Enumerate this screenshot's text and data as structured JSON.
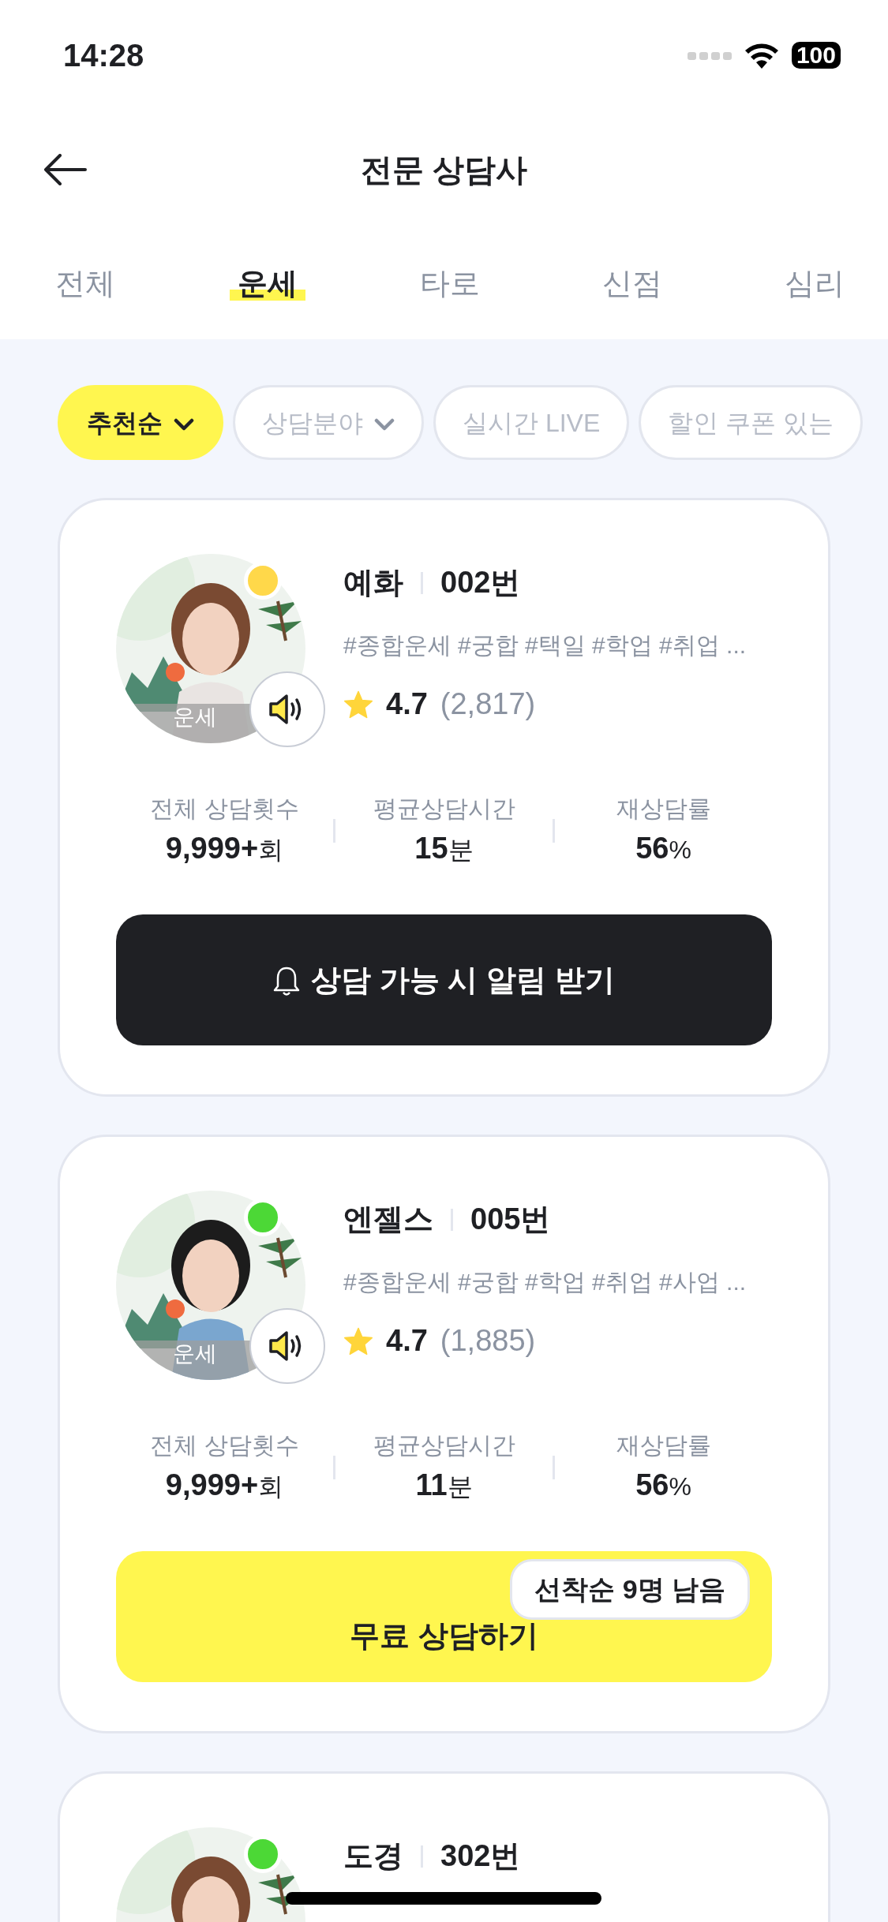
{
  "status_bar": {
    "time": "14:28",
    "battery": "100"
  },
  "header": {
    "title": "전문 상담사"
  },
  "tabs": [
    {
      "label": "전체",
      "selected": false
    },
    {
      "label": "운세",
      "selected": true
    },
    {
      "label": "타로",
      "selected": false
    },
    {
      "label": "신점",
      "selected": false
    },
    {
      "label": "심리",
      "selected": false
    }
  ],
  "filters": [
    {
      "label": "추천순",
      "selected": true,
      "dropdown": true
    },
    {
      "label": "상담분야",
      "selected": false,
      "dropdown": true
    },
    {
      "label": "실시간 LIVE",
      "selected": false,
      "dropdown": false
    },
    {
      "label": "할인 쿠폰 있는",
      "selected": false,
      "dropdown": false
    }
  ],
  "counselors": [
    {
      "name": "예화",
      "number": "002번",
      "color": "#ffd84a",
      "photo_tag": "운세",
      "tags": "#종합운세 #궁합 #택일 #학업 #취업 ...",
      "rating": "4.7",
      "reviews": "(2,817)",
      "stats": [
        {
          "label": "전체 상담횟수",
          "value": "9,999+",
          "unit": "회"
        },
        {
          "label": "평균상담시간",
          "value": "15",
          "unit": "분"
        },
        {
          "label": "재상담률",
          "value": "56",
          "unit": "%"
        }
      ],
      "action": {
        "kind": "notify",
        "label": "상담 가능 시 알림 받기"
      }
    },
    {
      "name": "엔젤스",
      "number": "005번",
      "color": "#4cd836",
      "photo_tag": "운세",
      "tags": "#종합운세 #궁합 #학업 #취업 #사업 ...",
      "rating": "4.7",
      "reviews": "(1,885)",
      "stats": [
        {
          "label": "전체 상담횟수",
          "value": "9,999+",
          "unit": "회"
        },
        {
          "label": "평균상담시간",
          "value": "11",
          "unit": "분"
        },
        {
          "label": "재상담률",
          "value": "56",
          "unit": "%"
        }
      ],
      "action": {
        "kind": "free",
        "label": "무료 상담하기",
        "badge": "선착순 **9명** 남음"
      }
    },
    {
      "name": "도경",
      "number": "302번",
      "color": "#4cd836"
    }
  ]
}
